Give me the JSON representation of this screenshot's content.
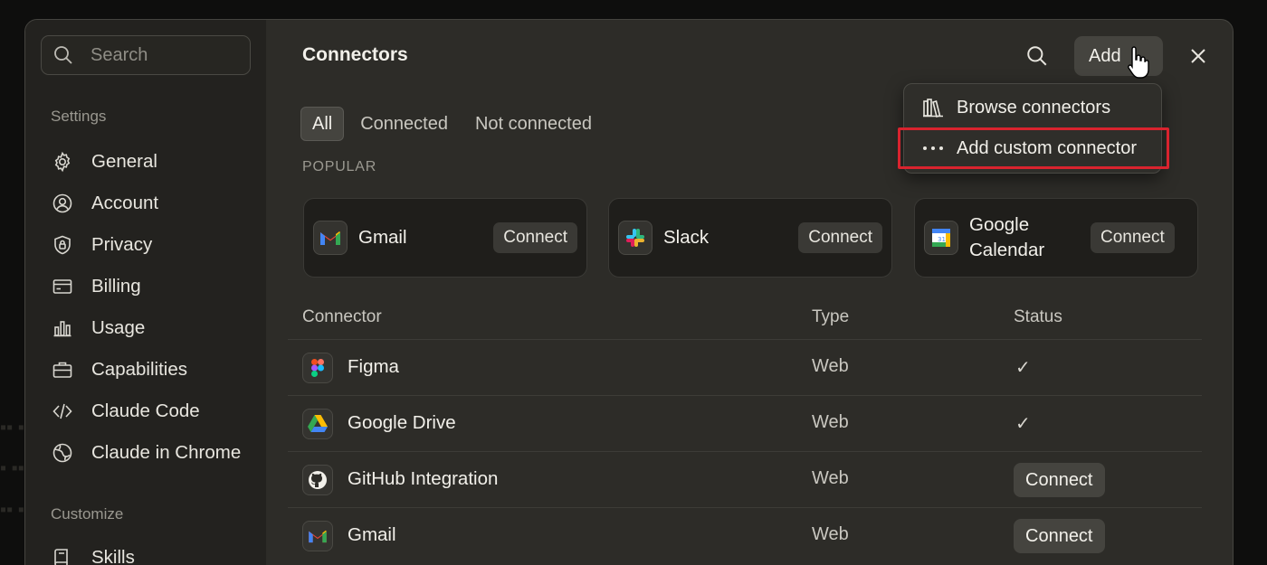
{
  "sidebar": {
    "search_placeholder": "Search",
    "settings_label": "Settings",
    "items": [
      {
        "label": "General",
        "icon": "gear-icon"
      },
      {
        "label": "Account",
        "icon": "user-circle-icon"
      },
      {
        "label": "Privacy",
        "icon": "shield-lock-icon"
      },
      {
        "label": "Billing",
        "icon": "credit-card-icon"
      },
      {
        "label": "Usage",
        "icon": "bar-chart-icon"
      },
      {
        "label": "Capabilities",
        "icon": "briefcase-icon"
      },
      {
        "label": "Claude Code",
        "icon": "code-icon"
      },
      {
        "label": "Claude in Chrome",
        "icon": "globe-icon"
      }
    ],
    "customize_label": "Customize",
    "customize_items": [
      {
        "label": "Skills",
        "icon": "skills-icon"
      }
    ]
  },
  "main": {
    "title": "Connectors",
    "add_label": "Add",
    "tabs": [
      "All",
      "Connected",
      "Not connected"
    ],
    "active_tab": "All",
    "popular_label": "POPULAR",
    "popular": [
      {
        "name": "Gmail",
        "button": "Connect"
      },
      {
        "name": "Slack",
        "button": "Connect"
      },
      {
        "name": "Google Calendar",
        "button": "Connect"
      }
    ],
    "table": {
      "headers": [
        "Connector",
        "Type",
        "Status"
      ],
      "rows": [
        {
          "name": "Figma",
          "type": "Web",
          "status": "✓"
        },
        {
          "name": "Google Drive",
          "type": "Web",
          "status": "✓"
        },
        {
          "name": "GitHub Integration",
          "type": "Web",
          "status": "Connect"
        },
        {
          "name": "Gmail",
          "type": "Web",
          "status": "Connect"
        }
      ]
    }
  },
  "dropdown": {
    "items": [
      {
        "label": "Browse connectors",
        "icon": "books-icon"
      },
      {
        "label": "Add custom connector",
        "icon": "ellipsis-icon"
      }
    ]
  },
  "colors": {
    "highlight": "#d9232e",
    "modal_bg": "#2d2c28",
    "sidebar_bg": "#23221f"
  }
}
